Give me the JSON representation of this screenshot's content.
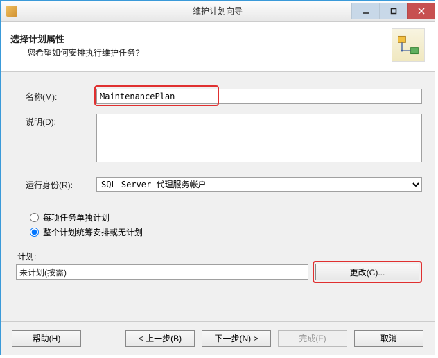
{
  "window": {
    "title": "维护计划向导"
  },
  "header": {
    "title": "选择计划属性",
    "subtitle": "您希望如何安排执行维护任务?"
  },
  "form": {
    "name_label": "名称(M):",
    "name_value": "MaintenancePlan",
    "desc_label": "说明(D):",
    "desc_value": "",
    "runas_label": "运行身份(R):",
    "runas_value": "SQL Server 代理服务帐户"
  },
  "radios": {
    "opt1_label": "每项任务单独计划",
    "opt2_label": "整个计划统筹安排或无计划",
    "selected": "opt2"
  },
  "plan": {
    "section_label": "计划:",
    "value": "未计划(按需)",
    "change_label": "更改(C)..."
  },
  "footer": {
    "help": "帮助(H)",
    "back": "< 上一步(B)",
    "next": "下一步(N) >",
    "finish": "完成(F)",
    "cancel": "取消"
  }
}
